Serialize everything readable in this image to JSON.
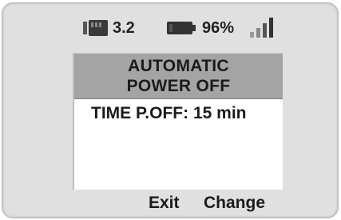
{
  "status_bar": {
    "sd_card": {
      "icon": "sd-card-icon",
      "value": "3.2"
    },
    "battery": {
      "icon": "battery-icon",
      "value": "96%"
    },
    "signal": {
      "icon": "signal-strength-icon",
      "bars": 4
    }
  },
  "screen": {
    "title_line1": "AUTOMATIC",
    "title_line2": "POWER OFF",
    "setting": "TIME P.OFF: 15 min"
  },
  "softkeys": {
    "left": "Exit",
    "right": "Change"
  },
  "colors": {
    "bezel": "#e0e0e0",
    "title_bar": "#a4a4a4",
    "screen": "#ffffff",
    "text": "#1b1b1b"
  }
}
